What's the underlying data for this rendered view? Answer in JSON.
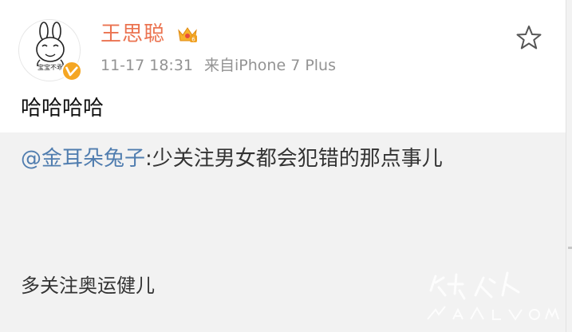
{
  "post": {
    "author": {
      "name": "王思聪",
      "avatar_caption": "宝宝不乖",
      "verified_icon": "verified-badge-icon",
      "member_icon": "crown-icon"
    },
    "timestamp": "11-17 18:31",
    "source": "来自iPhone 7 Plus",
    "favorite_icon": "star-outline-icon",
    "text": "哈哈哈哈"
  },
  "repost": {
    "mention": "@金耳朵兔子",
    "separator": ":",
    "text": "少关注男女都会犯错的那点事儿",
    "text2": "多关注奥运健儿"
  },
  "colors": {
    "username": "#eb7350",
    "mention": "#507daf",
    "meta": "#939393",
    "repost_bg": "#f2f2f2",
    "verified": "#f5a623"
  }
}
